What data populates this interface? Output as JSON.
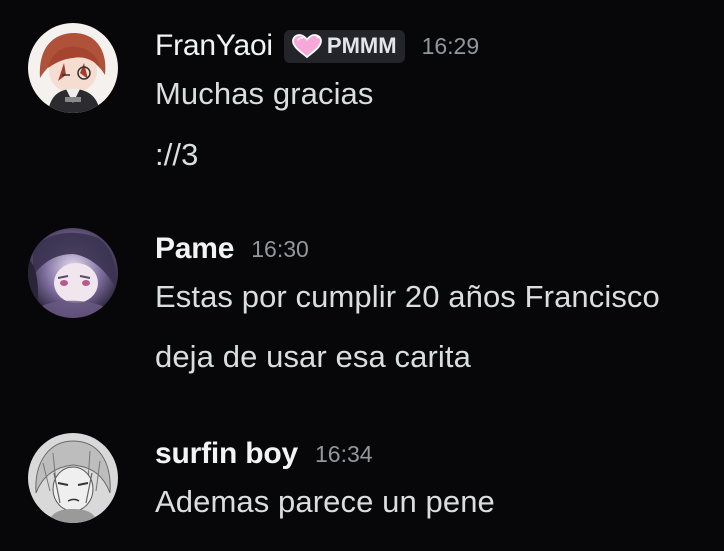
{
  "messages": [
    {
      "username": "FranYaoi",
      "tag": {
        "icon": "pink-heart-icon",
        "label": "PMMM"
      },
      "timestamp": "16:29",
      "lines": [
        "Muchas gracias",
        "://3"
      ]
    },
    {
      "username": "Pame",
      "timestamp": "16:30",
      "lines": [
        "Estas por cumplir 20 años Francisco",
        "deja de usar esa carita"
      ]
    },
    {
      "username": "surfin boy",
      "timestamp": "16:34",
      "lines": [
        "Ademas parece un pene"
      ]
    }
  ],
  "colors": {
    "background": "#070709",
    "username": "#f2f3f5",
    "message_text": "#dbdee1",
    "timestamp": "#94969d",
    "tag_bg": "#24252b",
    "heart": "#f7a8d8"
  }
}
